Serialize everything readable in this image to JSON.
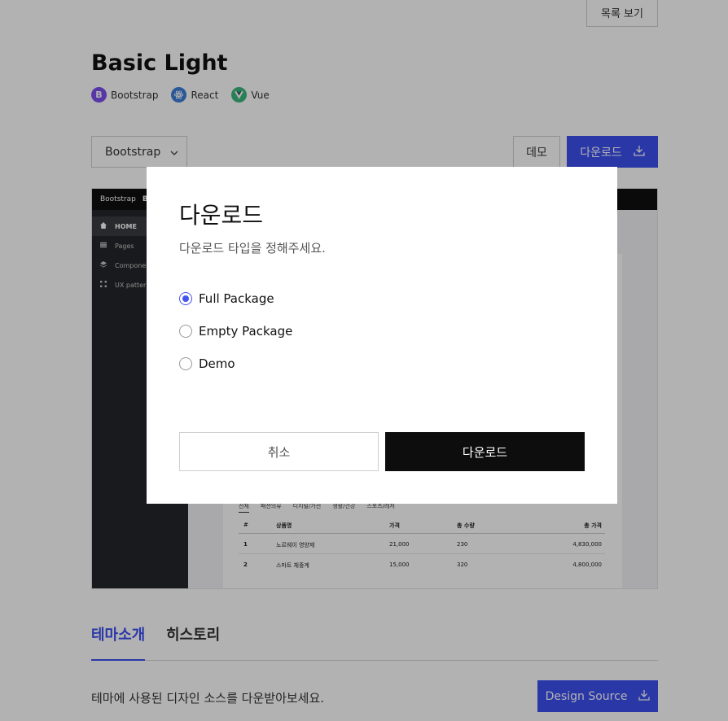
{
  "header": {
    "list_button": "목록 보기"
  },
  "theme": {
    "title": "Basic Light",
    "badges": [
      {
        "label": "Bootstrap",
        "icon": "bootstrap-icon",
        "letter": "B",
        "color": "#7d4ff0"
      },
      {
        "label": "React",
        "icon": "react-icon",
        "color": "#3d7fd8"
      },
      {
        "label": "Vue",
        "icon": "vue-icon",
        "color": "#3bb77e"
      }
    ]
  },
  "toolbar": {
    "framework_select": "Bootstrap",
    "demo_button": "데모",
    "download_button": "다운로드"
  },
  "preview": {
    "topbar_brand": "Bootstrap",
    "topbar_sub": "Ba",
    "sidebar": [
      {
        "label": "HOME",
        "icon": "home-icon",
        "active": true
      },
      {
        "label": "Pages",
        "icon": "pages-icon",
        "active": false
      },
      {
        "label": "Componen",
        "icon": "layers-icon",
        "active": false
      },
      {
        "label": "UX pattern",
        "icon": "ux-icon",
        "active": false
      }
    ],
    "table_tabs": [
      "전체",
      "패션의류",
      "디지털/가전",
      "생활/건강",
      "스포츠/레저"
    ],
    "table_headers": [
      "#",
      "상품명",
      "가격",
      "총 수량",
      "총 가격"
    ],
    "table_rows": [
      [
        "1",
        "노르웨이 영양제",
        "21,000",
        "230",
        "4,830,000"
      ],
      [
        "2",
        "스마트 체중계",
        "15,000",
        "320",
        "4,800,000"
      ]
    ]
  },
  "tabs": {
    "intro": "테마소개",
    "history": "히스토리"
  },
  "source": {
    "description": "테마에 사용된 디자인 소스를 다운받아보세요.",
    "button": "Design Source"
  },
  "modal": {
    "title": "다운로드",
    "subtitle": "다운로드 타입을 정해주세요.",
    "options": [
      {
        "label": "Full Package",
        "checked": true
      },
      {
        "label": "Empty Package",
        "checked": false
      },
      {
        "label": "Demo",
        "checked": false
      }
    ],
    "cancel_button": "취소",
    "confirm_button": "다운로드"
  },
  "colors": {
    "accent": "#3d4ff0",
    "overlay": "rgba(0,0,0,0.3)",
    "dark": "#0d0d0d"
  }
}
